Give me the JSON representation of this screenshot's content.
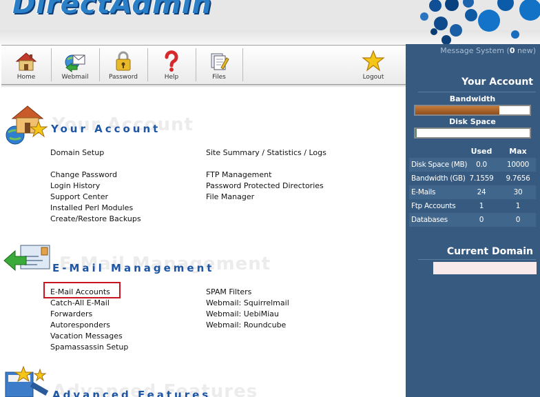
{
  "header": {
    "logo_text": "DirectAdmin"
  },
  "toolbar": {
    "items": [
      {
        "label": "Home",
        "icon": "home-icon"
      },
      {
        "label": "Webmail",
        "icon": "webmail-icon"
      },
      {
        "label": "Password",
        "icon": "padlock-icon"
      },
      {
        "label": "Help",
        "icon": "question-mark-icon"
      },
      {
        "label": "Files",
        "icon": "files-icon"
      },
      {
        "label": "Logout",
        "icon": "star-icon"
      }
    ]
  },
  "sidebar": {
    "message_prefix": "Message System (",
    "message_count": "0",
    "message_suffix": " new)",
    "your_account_title": "Your Account",
    "bandwidth_label": "Bandwidth",
    "bandwidth_used_fraction": 0.733,
    "disk_label": "Disk Space",
    "disk_used_fraction": 0.0,
    "colors": {
      "panel": "#365a80",
      "bandwidth_fill": "#c57a3a",
      "disk_fill": "#5d8a6a"
    },
    "stats_header": {
      "used": "Used",
      "max": "Max"
    },
    "stats": [
      {
        "name": "Disk Space (MB)",
        "used": "0.0",
        "max": "10000"
      },
      {
        "name": "Bandwidth (GB)",
        "used": "7.1559",
        "max": "9.7656"
      },
      {
        "name": "E-Mails",
        "used": "24",
        "max": "30"
      },
      {
        "name": "Ftp Accounts",
        "used": "1",
        "max": "1"
      },
      {
        "name": "Databases",
        "used": "0",
        "max": "0"
      }
    ],
    "current_domain_title": "Current Domain"
  },
  "sections": {
    "account": {
      "title": "Your Account",
      "ghost": "Your Account",
      "left": [
        "Domain Setup",
        "Change Password",
        "Login History",
        "Support Center",
        "Installed Perl Modules",
        "Create/Restore Backups"
      ],
      "right": [
        "Site Summary / Statistics / Logs",
        "FTP Management",
        "Password Protected Directories",
        "File Manager"
      ]
    },
    "email": {
      "title": "E-Mail Management",
      "ghost": "E-Mail Management",
      "left": [
        "E-Mail Accounts",
        "Catch-All E-Mail",
        "Forwarders",
        "Autoresponders",
        "Vacation Messages",
        "Spamassassin Setup"
      ],
      "right": [
        "SPAM Filters",
        "Webmail: Squirrelmail",
        "Webmail: UebiMiau",
        "Webmail: Roundcube"
      ]
    },
    "advanced": {
      "title": "Advanced Features",
      "ghost": "Advanced Features"
    }
  }
}
